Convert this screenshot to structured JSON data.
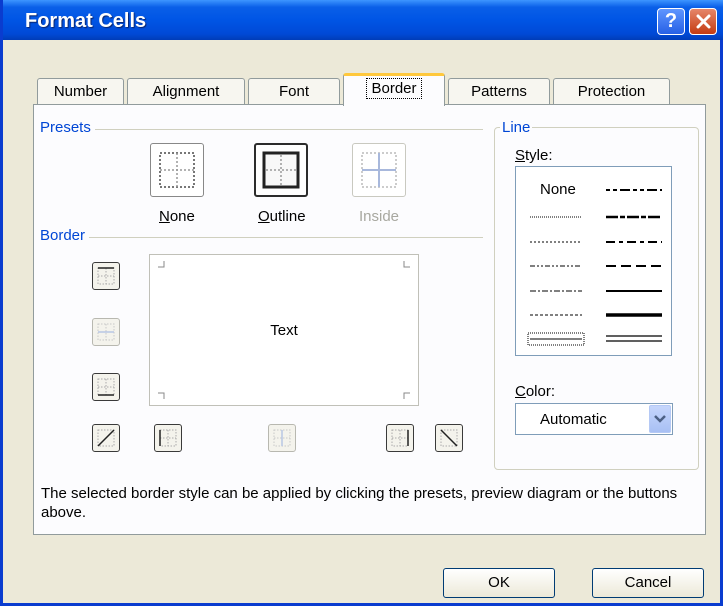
{
  "window": {
    "title": "Format Cells",
    "help_label": "?"
  },
  "tabs": [
    {
      "label": "Number"
    },
    {
      "label": "Alignment"
    },
    {
      "label": "Font"
    },
    {
      "label": "Border",
      "selected": true
    },
    {
      "label": "Patterns"
    },
    {
      "label": "Protection"
    }
  ],
  "presets": {
    "group_label": "Presets",
    "none": {
      "key": "N",
      "rest": "one"
    },
    "outline": {
      "key": "O",
      "rest": "utline"
    },
    "inside": {
      "label": "Inside",
      "disabled": true
    }
  },
  "border": {
    "group_label": "Border",
    "preview_text": "Text"
  },
  "line": {
    "group_label": "Line",
    "style_key": "S",
    "style_rest": "tyle:",
    "style_none": "None",
    "color_key": "C",
    "color_rest": "olor:",
    "color_value": "Automatic"
  },
  "description": "The selected border style can be applied by clicking the presets, preview diagram or the buttons above.",
  "buttons": {
    "ok": "OK",
    "cancel": "Cancel"
  },
  "colors": {
    "titlebar": "#0055e5",
    "dialog_bg": "#ece9d8",
    "group_label": "#0046d5",
    "active_tab_accent": "#ffc83c"
  }
}
